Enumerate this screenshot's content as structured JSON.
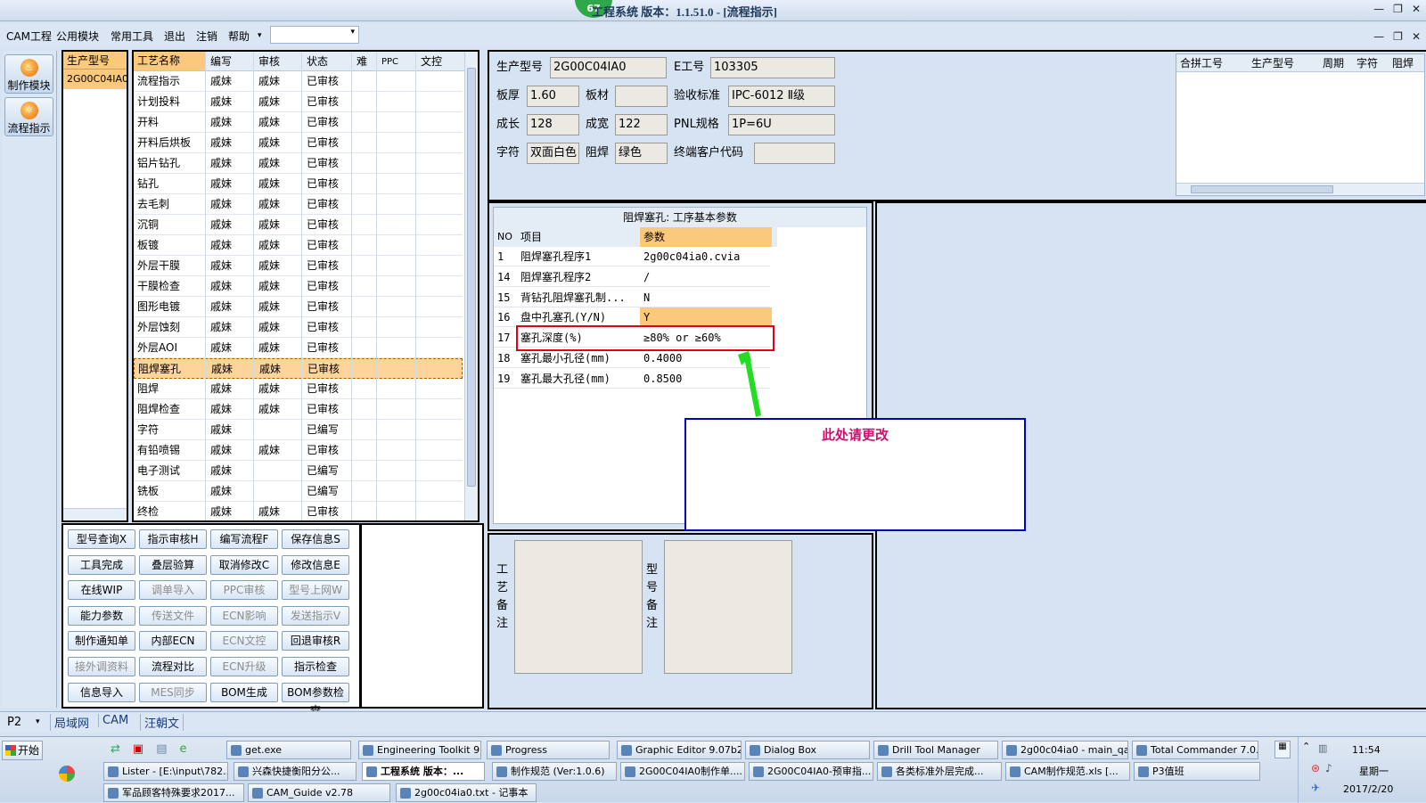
{
  "window": {
    "title": "工程系统  版本：1.1.51.0 - [流程指示]",
    "badge": "67"
  },
  "menu": [
    "CAM工程",
    "公用模块",
    "常用工具",
    "退出",
    "注销",
    "帮助"
  ],
  "left_buttons": [
    "制作模块",
    "流程指示"
  ],
  "model_panel": {
    "header": "生产型号",
    "item": "2G00C04IA0"
  },
  "flow_table": {
    "headers": [
      "工艺名称",
      "编写",
      "审核",
      "状态",
      "难",
      "PPC",
      "文控"
    ],
    "rows": [
      [
        "流程指示",
        "戚妹",
        "戚妹",
        "已审核"
      ],
      [
        "计划投料",
        "戚妹",
        "戚妹",
        "已审核"
      ],
      [
        "开料",
        "戚妹",
        "戚妹",
        "已审核"
      ],
      [
        "开料后烘板",
        "戚妹",
        "戚妹",
        "已审核"
      ],
      [
        "铝片钻孔",
        "戚妹",
        "戚妹",
        "已审核"
      ],
      [
        "钻孔",
        "戚妹",
        "戚妹",
        "已审核"
      ],
      [
        "去毛刺",
        "戚妹",
        "戚妹",
        "已审核"
      ],
      [
        "沉铜",
        "戚妹",
        "戚妹",
        "已审核"
      ],
      [
        "板镀",
        "戚妹",
        "戚妹",
        "已审核"
      ],
      [
        "外层干膜",
        "戚妹",
        "戚妹",
        "已审核"
      ],
      [
        "干膜检查",
        "戚妹",
        "戚妹",
        "已审核"
      ],
      [
        "图形电镀",
        "戚妹",
        "戚妹",
        "已审核"
      ],
      [
        "外层蚀刻",
        "戚妹",
        "戚妹",
        "已审核"
      ],
      [
        "外层AOI",
        "戚妹",
        "戚妹",
        "已审核"
      ],
      [
        "阻焊塞孔",
        "戚妹",
        "戚妹",
        "已审核"
      ],
      [
        "阻焊",
        "戚妹",
        "戚妹",
        "已审核"
      ],
      [
        "阻焊检查",
        "戚妹",
        "戚妹",
        "已审核"
      ],
      [
        "字符",
        "戚妹",
        "",
        "已编写"
      ],
      [
        "有铅喷锡",
        "戚妹",
        "戚妹",
        "已审核"
      ],
      [
        "电子测试",
        "戚妹",
        "",
        "已编写"
      ],
      [
        "铣板",
        "戚妹",
        "",
        "已编写"
      ],
      [
        "终检",
        "戚妹",
        "戚妹",
        "已审核"
      ]
    ],
    "selected": 14
  },
  "buttons": [
    [
      "型号查询X",
      "指示审核H",
      "编写流程F",
      "保存信息S"
    ],
    [
      "工具完成",
      "叠层验算",
      "取消修改C",
      "修改信息E"
    ],
    [
      "在线WIP",
      "调单导入",
      "PPC审核",
      "型号上网W"
    ],
    [
      "能力参数",
      "传送文件",
      "ECN影响",
      "发送指示V"
    ],
    [
      "制作通知单",
      "内部ECN",
      "ECN文控",
      "回退审核R"
    ],
    [
      "接外调资料",
      "流程对比",
      "ECN升级",
      "指示检查"
    ],
    [
      "信息导入",
      "MES同步",
      "BOM生成",
      "BOM参数检查"
    ]
  ],
  "disabled_buttons": [
    "调单导入",
    "PPC审核",
    "型号上网W",
    "传送文件",
    "ECN影响",
    "发送指示V",
    "ECN文控",
    "接外调资料",
    "ECN升级",
    "MES同步"
  ],
  "info": {
    "model_label": "生产型号",
    "model": "2G00C04IA0",
    "eno_label": "E工号",
    "eno": "103305",
    "thick_label": "板厚",
    "thick": "1.60",
    "mat_label": "板材",
    "mat": "",
    "std_label": "验收标准",
    "std": "IPC-6012 Ⅱ级",
    "len_label": "成长",
    "len": "128",
    "wid_label": "成宽",
    "wid": "122",
    "pnl_label": "PNL规格",
    "pnl": "1P=6U",
    "char_label": "字符",
    "char": "双面白色",
    "mask_label": "阻焊",
    "mask": "绿色",
    "cust_label": "终端客户代码",
    "cust": ""
  },
  "merge_table": {
    "headers": [
      "合拼工号",
      "生产型号",
      "周期",
      "字符",
      "阻焊"
    ]
  },
  "param_table": {
    "title": "阻焊塞孔: 工序基本参数",
    "headers": [
      "NO",
      "项目",
      "参数"
    ],
    "rows": [
      [
        "1",
        "阻焊塞孔程序1",
        "2g00c04ia0.cvia"
      ],
      [
        "14",
        "阻焊塞孔程序2",
        "/"
      ],
      [
        "15",
        "背钻孔阻焊塞孔制...",
        "N"
      ],
      [
        "16",
        "盘中孔塞孔(Y/N)",
        "Y"
      ],
      [
        "17",
        "塞孔深度(%)",
        "≥80% or ≥60%"
      ],
      [
        "18",
        "塞孔最小孔径(mm)",
        "0.4000"
      ],
      [
        "19",
        "塞孔最大孔径(mm)",
        "0.8500"
      ]
    ]
  },
  "annotation": {
    "text": "此处请更改",
    "color": "#d0106e",
    "box_color": "#0000c0",
    "highlight_color": "#e0001a",
    "arrow_color": "#22dd22"
  },
  "remarks": {
    "process": "工艺备注",
    "model": "型号备注"
  },
  "statusbar": {
    "combo": "P2",
    "tabs": [
      "局域网",
      "CAM",
      "汪朝文"
    ]
  },
  "taskbar": {
    "start": "开始",
    "row1": [
      "get.exe",
      "Engineering Toolkit 9....",
      "Progress",
      "Graphic Editor 9.07b2...",
      "Dialog Box",
      "Drill Tool Manager",
      "2g00c04ia0 - main_qa",
      "Total Commander 7.0..."
    ],
    "row2": [
      "Lister - [E:\\input\\782...",
      "兴森快捷衡阳分公...",
      "工程系统  版本：...",
      "制作规范 (Ver:1.0.6)",
      "2G00C04IA0制作单....",
      "2G00C04IA0-预审指...",
      "各类标准外层完成...",
      "CAM制作规范.xls  [...",
      "P3值班"
    ],
    "row3": [
      "军品顾客特殊要求2017...",
      "CAM_Guide v2.78",
      "2g00c04ia0.txt - 记事本"
    ],
    "time": "11:54",
    "day": "星期一",
    "date": "2017/2/20"
  }
}
